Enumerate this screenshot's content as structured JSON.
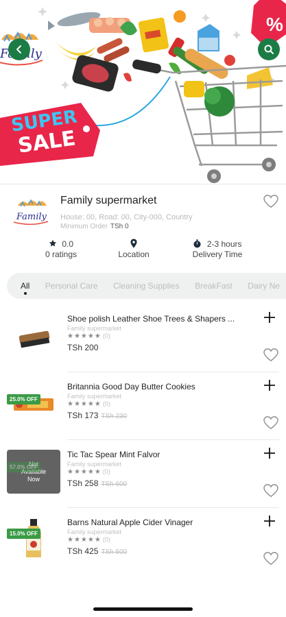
{
  "banner": {
    "sale_line1": "SUPER",
    "sale_line2": "SALE",
    "percent_sign": "%",
    "logo_text": "Family"
  },
  "store": {
    "name": "Family supermarket",
    "address": "House: 00, Road: 00, City-000, Country",
    "min_order_label": "Minimum Order",
    "min_order_value": "TSh 0",
    "logo_text": "Family"
  },
  "stats": {
    "rating_value": "0.0",
    "rating_label": "0 ratings",
    "location_label": "Location",
    "delivery_value": "2-3 hours",
    "delivery_label": "Delivery Time"
  },
  "tabs": [
    "All",
    "Personal Care",
    "Cleaning Supplies",
    "BreakFast",
    "Dairy Ne"
  ],
  "products": [
    {
      "name": "Shoe polish Leather Shoe Trees & Shapers ...",
      "store": "Family supermarket",
      "stars": "★★★★★",
      "rating_count": "(0)",
      "price": "TSh 200",
      "old_price": "",
      "discount": "",
      "unavailable": ""
    },
    {
      "name": "Britannia Good Day Butter Cookies",
      "store": "Family supermarket",
      "stars": "★★★★★",
      "rating_count": "(0)",
      "price": "TSh 173",
      "old_price": "TSh 230",
      "discount": "25.0% OFF",
      "unavailable": ""
    },
    {
      "name": "Tic Tac Spear Mint Falvor",
      "store": "Family supermarket",
      "stars": "★★★★★",
      "rating_count": "(0)",
      "price": "TSh 258",
      "old_price": "TSh 600",
      "discount": "57.0% OFF",
      "unavailable": "Not Available Now"
    },
    {
      "name": "Barns Natural Apple Cider Vinager",
      "store": "Family supermarket",
      "stars": "★★★★★",
      "rating_count": "(0)",
      "price": "TSh 425",
      "old_price": "TSh 500",
      "discount": "15.0% OFF",
      "unavailable": ""
    }
  ],
  "colors": {
    "accent": "#1c7c45",
    "sale_tag": "#e8264a",
    "discount_badge": "#3a9b45",
    "star": "#1f2d3a"
  }
}
